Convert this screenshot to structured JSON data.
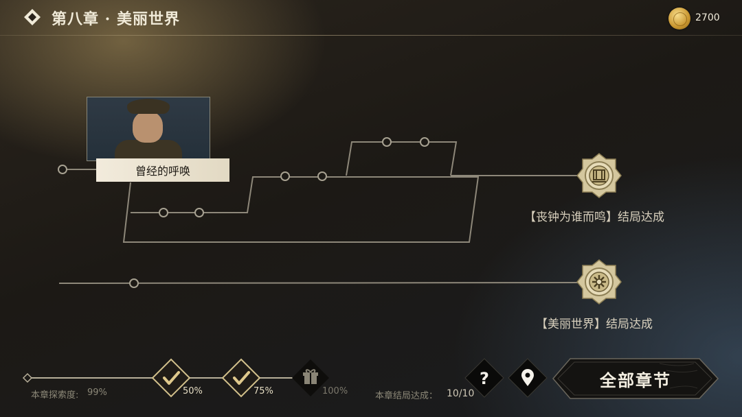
{
  "header": {
    "title": "第八章 · 美丽世界",
    "coin_count": "2700"
  },
  "story_map": {
    "current_node_label": "曾经的呼唤",
    "endings": [
      {
        "label": "【丧钟为谁而鸣】结局达成"
      },
      {
        "label": "【美丽世界】结局达成"
      }
    ]
  },
  "progress": {
    "explore_label": "本章探索度:",
    "explore_value": "99%",
    "exploration_fraction": 0.99,
    "milestones": [
      {
        "label": "50%",
        "state": "completed",
        "icon": "check-icon"
      },
      {
        "label": "75%",
        "state": "completed",
        "icon": "check-icon"
      },
      {
        "label": "100%",
        "state": "locked",
        "icon": "gift-icon"
      }
    ],
    "ending_label": "本章结局达成：",
    "ending_value": "10/10"
  },
  "actions": {
    "help_icon": "question-icon",
    "location_icon": "map-pin-icon",
    "all_chapters_label": "全部章节"
  },
  "colors": {
    "accent_gold": "#d9c48a",
    "line": "#9a9384",
    "text_light": "#f0ead8"
  }
}
